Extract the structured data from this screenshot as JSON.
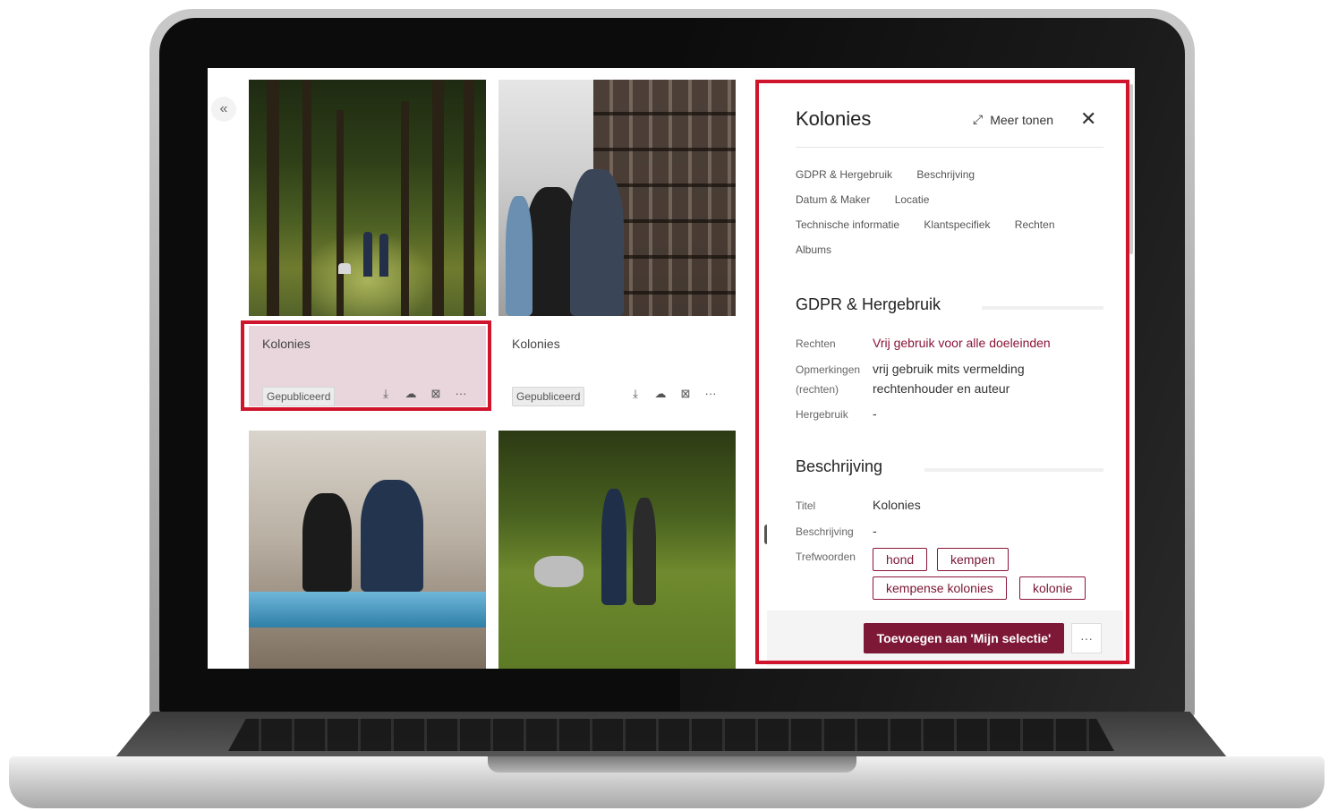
{
  "grid": {
    "cards": [
      {
        "title": "Kolonies",
        "status": "Gepubliceerd"
      },
      {
        "title": "Kolonies",
        "status": "Gepubliceerd"
      }
    ],
    "actions": {
      "more": "···"
    }
  },
  "panel": {
    "title": "Kolonies",
    "meer_tonen": "Meer tonen",
    "tabs": [
      "GDPR & Hergebruik",
      "Beschrijving",
      "Datum & Maker",
      "Locatie",
      "Technische informatie",
      "Klantspecifiek",
      "Rechten",
      "Albums"
    ],
    "gdpr": {
      "heading": "GDPR & Hergebruik",
      "rechten_label": "Rechten",
      "rechten_value": "Vrij gebruik voor alle doeleinden",
      "opmerkingen_label": "Opmerkingen (rechten)",
      "opmerkingen_value": "vrij gebruik mits vermelding rechtenhouder en auteur",
      "hergebruik_label": "Hergebruik",
      "hergebruik_value": "-"
    },
    "beschrijving": {
      "heading": "Beschrijving",
      "titel_label": "Titel",
      "titel_value": "Kolonies",
      "beschrijving_label": "Beschrijving",
      "beschrijving_value": "-",
      "trefwoorden_label": "Trefwoorden",
      "tags": [
        "hond",
        "kempen",
        "kempense kolonies",
        "kolonie"
      ]
    },
    "footer": {
      "add_button": "Toevoegen aan 'Mijn selectie'",
      "more_button": "···"
    }
  },
  "colors": {
    "accent": "#7d1836",
    "highlight": "#d0142c",
    "selected_card": "#e8d6dc"
  }
}
